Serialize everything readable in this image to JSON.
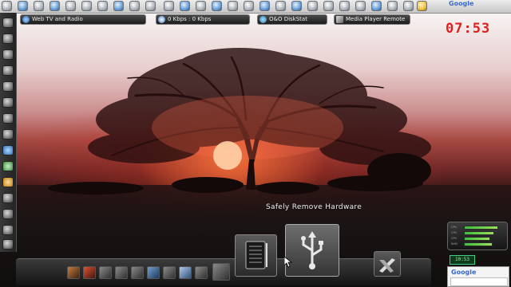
{
  "toolbar": {
    "bars": [
      {
        "label": "Web TV and Radio",
        "icon": "globe-icon"
      },
      {
        "label": "0 Kbps : 0 Kbps",
        "icon": "network-icon"
      },
      {
        "label": "O&O DiskStat",
        "icon": "disk-icon"
      },
      {
        "label": "Media Player Remote",
        "icon": "media-player-icon"
      }
    ],
    "google_label": "Google"
  },
  "clock": {
    "time": "07:53"
  },
  "notification": {
    "label": "Safely Remove Hardware"
  },
  "gadget": {
    "meters": [
      {
        "label": "CPU",
        "level": 0.82
      },
      {
        "label": "CPU",
        "level": 0.74
      },
      {
        "label": "CPU",
        "level": 0.64
      },
      {
        "label": "RAM",
        "level": 0.7
      }
    ],
    "small_clock": "10:53",
    "google_label": "Google"
  },
  "colors": {
    "clock": "#e0201c",
    "meter": "#3fbf3f",
    "accent": "#3a6ad0"
  }
}
